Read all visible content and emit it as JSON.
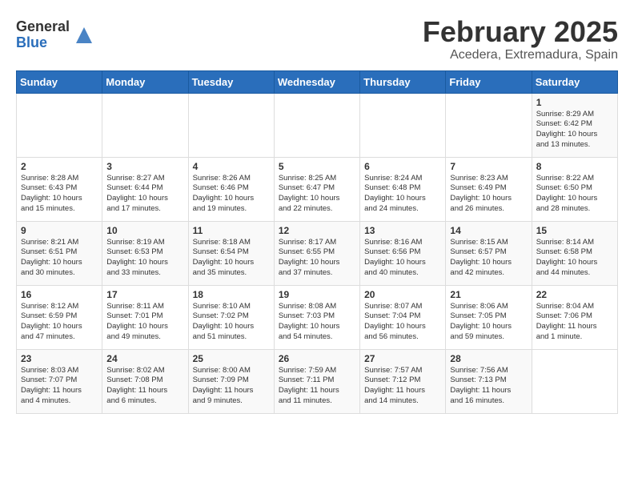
{
  "header": {
    "logo_general": "General",
    "logo_blue": "Blue",
    "month_title": "February 2025",
    "location": "Acedera, Extremadura, Spain"
  },
  "weekdays": [
    "Sunday",
    "Monday",
    "Tuesday",
    "Wednesday",
    "Thursday",
    "Friday",
    "Saturday"
  ],
  "weeks": [
    [
      {
        "day": "",
        "info": ""
      },
      {
        "day": "",
        "info": ""
      },
      {
        "day": "",
        "info": ""
      },
      {
        "day": "",
        "info": ""
      },
      {
        "day": "",
        "info": ""
      },
      {
        "day": "",
        "info": ""
      },
      {
        "day": "1",
        "info": "Sunrise: 8:29 AM\nSunset: 6:42 PM\nDaylight: 10 hours\nand 13 minutes."
      }
    ],
    [
      {
        "day": "2",
        "info": "Sunrise: 8:28 AM\nSunset: 6:43 PM\nDaylight: 10 hours\nand 15 minutes."
      },
      {
        "day": "3",
        "info": "Sunrise: 8:27 AM\nSunset: 6:44 PM\nDaylight: 10 hours\nand 17 minutes."
      },
      {
        "day": "4",
        "info": "Sunrise: 8:26 AM\nSunset: 6:46 PM\nDaylight: 10 hours\nand 19 minutes."
      },
      {
        "day": "5",
        "info": "Sunrise: 8:25 AM\nSunset: 6:47 PM\nDaylight: 10 hours\nand 22 minutes."
      },
      {
        "day": "6",
        "info": "Sunrise: 8:24 AM\nSunset: 6:48 PM\nDaylight: 10 hours\nand 24 minutes."
      },
      {
        "day": "7",
        "info": "Sunrise: 8:23 AM\nSunset: 6:49 PM\nDaylight: 10 hours\nand 26 minutes."
      },
      {
        "day": "8",
        "info": "Sunrise: 8:22 AM\nSunset: 6:50 PM\nDaylight: 10 hours\nand 28 minutes."
      }
    ],
    [
      {
        "day": "9",
        "info": "Sunrise: 8:21 AM\nSunset: 6:51 PM\nDaylight: 10 hours\nand 30 minutes."
      },
      {
        "day": "10",
        "info": "Sunrise: 8:19 AM\nSunset: 6:53 PM\nDaylight: 10 hours\nand 33 minutes."
      },
      {
        "day": "11",
        "info": "Sunrise: 8:18 AM\nSunset: 6:54 PM\nDaylight: 10 hours\nand 35 minutes."
      },
      {
        "day": "12",
        "info": "Sunrise: 8:17 AM\nSunset: 6:55 PM\nDaylight: 10 hours\nand 37 minutes."
      },
      {
        "day": "13",
        "info": "Sunrise: 8:16 AM\nSunset: 6:56 PM\nDaylight: 10 hours\nand 40 minutes."
      },
      {
        "day": "14",
        "info": "Sunrise: 8:15 AM\nSunset: 6:57 PM\nDaylight: 10 hours\nand 42 minutes."
      },
      {
        "day": "15",
        "info": "Sunrise: 8:14 AM\nSunset: 6:58 PM\nDaylight: 10 hours\nand 44 minutes."
      }
    ],
    [
      {
        "day": "16",
        "info": "Sunrise: 8:12 AM\nSunset: 6:59 PM\nDaylight: 10 hours\nand 47 minutes."
      },
      {
        "day": "17",
        "info": "Sunrise: 8:11 AM\nSunset: 7:01 PM\nDaylight: 10 hours\nand 49 minutes."
      },
      {
        "day": "18",
        "info": "Sunrise: 8:10 AM\nSunset: 7:02 PM\nDaylight: 10 hours\nand 51 minutes."
      },
      {
        "day": "19",
        "info": "Sunrise: 8:08 AM\nSunset: 7:03 PM\nDaylight: 10 hours\nand 54 minutes."
      },
      {
        "day": "20",
        "info": "Sunrise: 8:07 AM\nSunset: 7:04 PM\nDaylight: 10 hours\nand 56 minutes."
      },
      {
        "day": "21",
        "info": "Sunrise: 8:06 AM\nSunset: 7:05 PM\nDaylight: 10 hours\nand 59 minutes."
      },
      {
        "day": "22",
        "info": "Sunrise: 8:04 AM\nSunset: 7:06 PM\nDaylight: 11 hours\nand 1 minute."
      }
    ],
    [
      {
        "day": "23",
        "info": "Sunrise: 8:03 AM\nSunset: 7:07 PM\nDaylight: 11 hours\nand 4 minutes."
      },
      {
        "day": "24",
        "info": "Sunrise: 8:02 AM\nSunset: 7:08 PM\nDaylight: 11 hours\nand 6 minutes."
      },
      {
        "day": "25",
        "info": "Sunrise: 8:00 AM\nSunset: 7:09 PM\nDaylight: 11 hours\nand 9 minutes."
      },
      {
        "day": "26",
        "info": "Sunrise: 7:59 AM\nSunset: 7:11 PM\nDaylight: 11 hours\nand 11 minutes."
      },
      {
        "day": "27",
        "info": "Sunrise: 7:57 AM\nSunset: 7:12 PM\nDaylight: 11 hours\nand 14 minutes."
      },
      {
        "day": "28",
        "info": "Sunrise: 7:56 AM\nSunset: 7:13 PM\nDaylight: 11 hours\nand 16 minutes."
      },
      {
        "day": "",
        "info": ""
      }
    ]
  ]
}
